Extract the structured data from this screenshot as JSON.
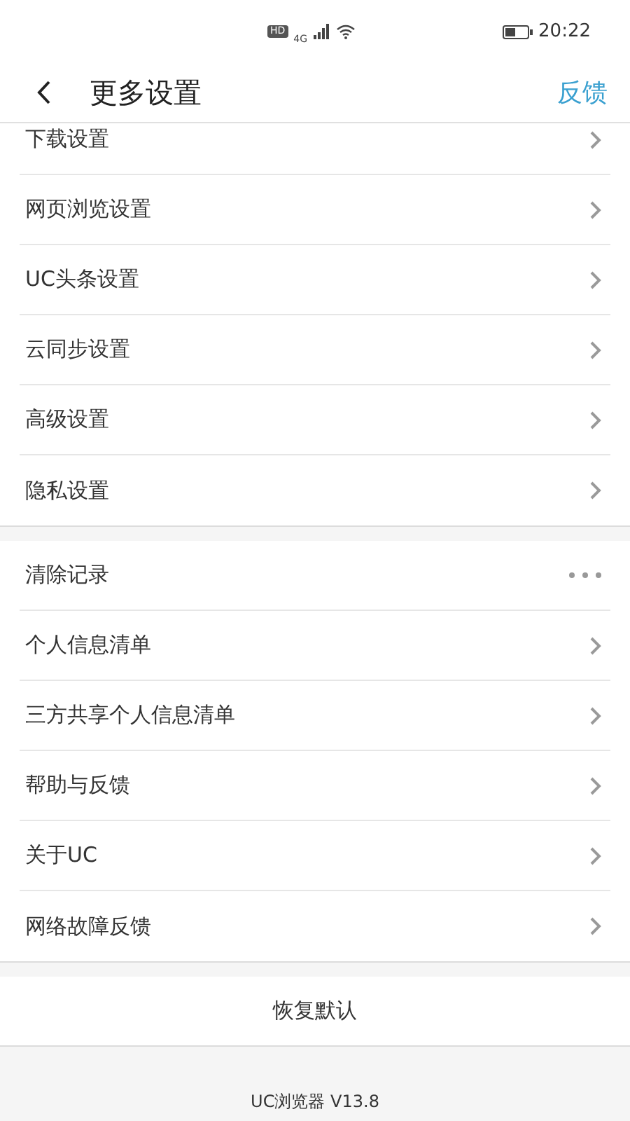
{
  "status_bar": {
    "hd": "HD",
    "network": "4G",
    "time": "20:22"
  },
  "header": {
    "title": "更多设置",
    "action": "反馈"
  },
  "groups": [
    {
      "items": [
        {
          "label": "下载设置",
          "kind": "chevron"
        },
        {
          "label": "网页浏览设置",
          "kind": "chevron"
        },
        {
          "label": "UC头条设置",
          "kind": "chevron"
        },
        {
          "label": "云同步设置",
          "kind": "chevron"
        },
        {
          "label": "高级设置",
          "kind": "chevron"
        },
        {
          "label": "隐私设置",
          "kind": "chevron"
        }
      ]
    },
    {
      "items": [
        {
          "label": "清除记录",
          "kind": "more"
        },
        {
          "label": "个人信息清单",
          "kind": "chevron"
        },
        {
          "label": "三方共享个人信息清单",
          "kind": "chevron"
        },
        {
          "label": "帮助与反馈",
          "kind": "chevron"
        },
        {
          "label": "关于UC",
          "kind": "chevron"
        },
        {
          "label": "网络故障反馈",
          "kind": "chevron"
        }
      ]
    }
  ],
  "reset_button": "恢复默认",
  "version": "UC浏览器 V13.8"
}
